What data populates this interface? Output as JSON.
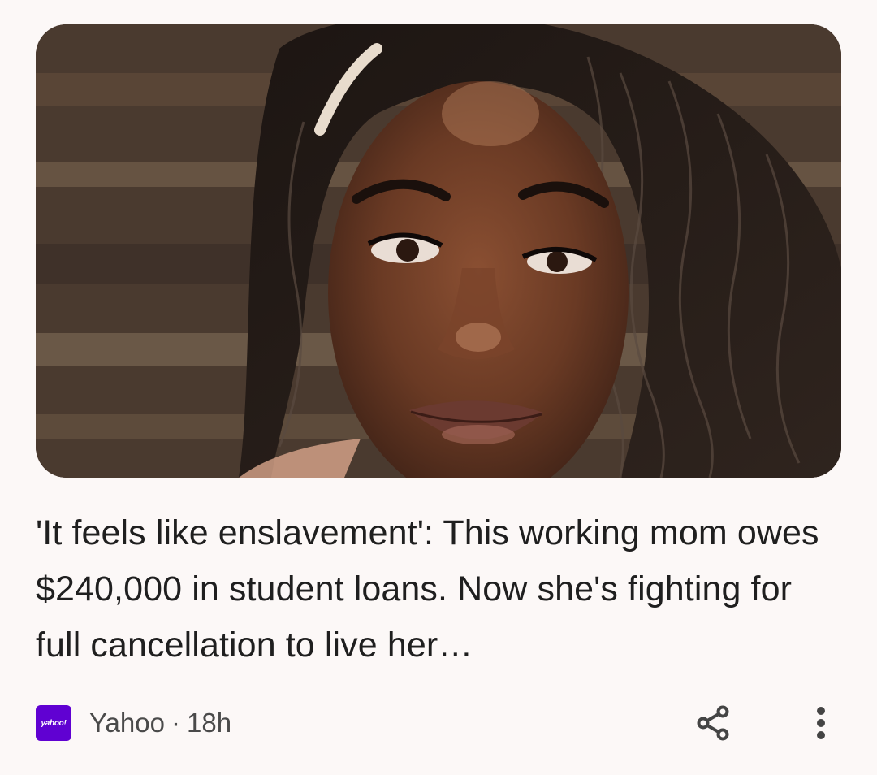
{
  "article": {
    "headline": "'It feels like enslavement': This working mom owes $240,000 in student loans. Now she's fighting for full cancellation to live her…",
    "source_logo_text": "yahoo!",
    "source_name": "Yahoo",
    "separator": "·",
    "age": "18h",
    "logo_color": "#6001d2"
  },
  "icons": {
    "share": "share-icon",
    "more": "more-vert-icon"
  }
}
